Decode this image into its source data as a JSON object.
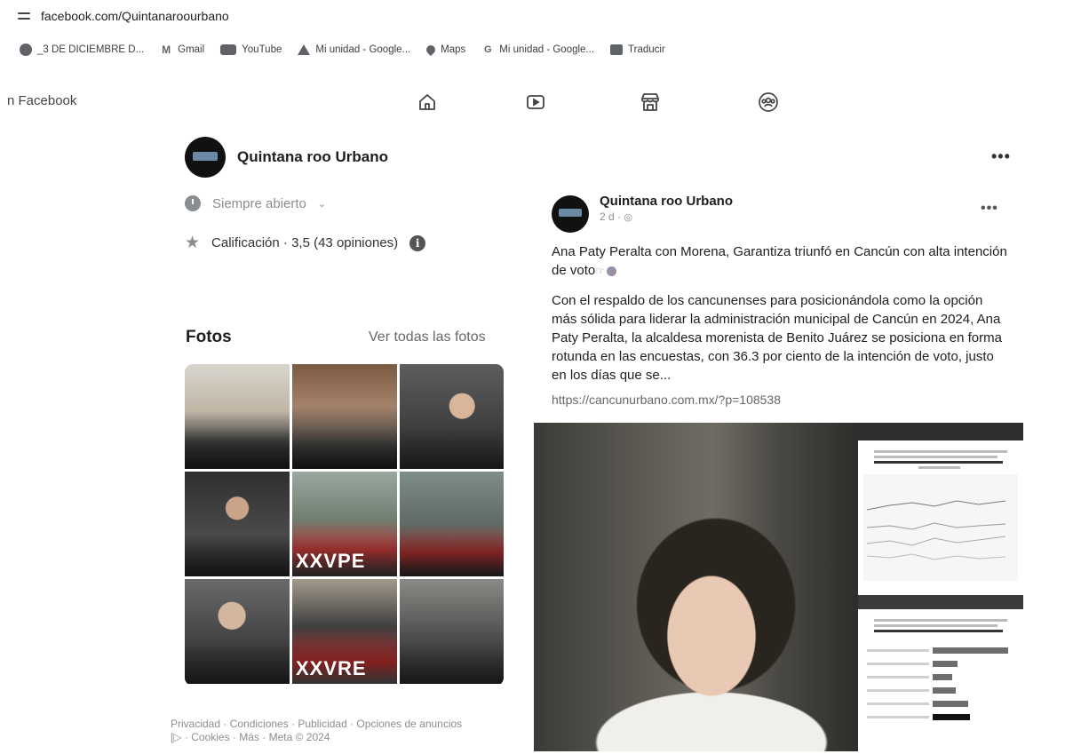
{
  "browser": {
    "url": "facebook.com/Quintanaroourbano",
    "bookmarks": [
      {
        "label": "_3 DE DICIEMBRE D...",
        "icon": "globe-icon"
      },
      {
        "label": "Gmail",
        "icon": "gmail-icon"
      },
      {
        "label": "YouTube",
        "icon": "youtube-icon"
      },
      {
        "label": "Mi unidad - Google...",
        "icon": "drive-icon"
      },
      {
        "label": "Maps",
        "icon": "maps-icon"
      },
      {
        "label": "Mi unidad - Google...",
        "icon": "google-icon"
      },
      {
        "label": "Traducir",
        "icon": "translate-icon"
      }
    ]
  },
  "fb_nav": {
    "left_label": "n Facebook",
    "icons": [
      "home-icon",
      "video-icon",
      "marketplace-icon",
      "groups-icon"
    ]
  },
  "page": {
    "name": "Quintana roo Urbano",
    "more": "•••",
    "hours": "Siempre abierto",
    "rating": "Calificación · 3,5 (43 opiniones)",
    "info_glyph": "i"
  },
  "photos": {
    "title": "Fotos",
    "see_all": "Ver todas las fotos",
    "overlay_texts": [
      "XXVPE",
      "XXVRE"
    ]
  },
  "footer": {
    "line1": "Privacidad · Condiciones · Publicidad · Opciones de anuncios",
    "line2": "[▷ · Cookies · Más · Meta © 2024"
  },
  "post": {
    "author": "Quintana roo Urbano",
    "meta": "2 d ·",
    "more": "•••",
    "headline": "Ana Paty Peralta con Morena, Garantiza triunfó en Cancún con alta intención de voto",
    "body": "Con el respaldo de los cancunenses para posicionándola como la opción más sólida para liderar la administración municipal de Cancún en 2024, Ana Paty Peralta, la alcaldesa morenista de Benito Juárez se posiciona en forma rotunda en las encuestas, con 36.3 por ciento de la intención de voto, justo en los días que se...",
    "link": "https://cancunurbano.com.mx/?p=108538"
  },
  "colors": {
    "text_primary": "#1c1e21",
    "text_secondary": "#65676b",
    "icon_gray": "#8a8d91"
  }
}
